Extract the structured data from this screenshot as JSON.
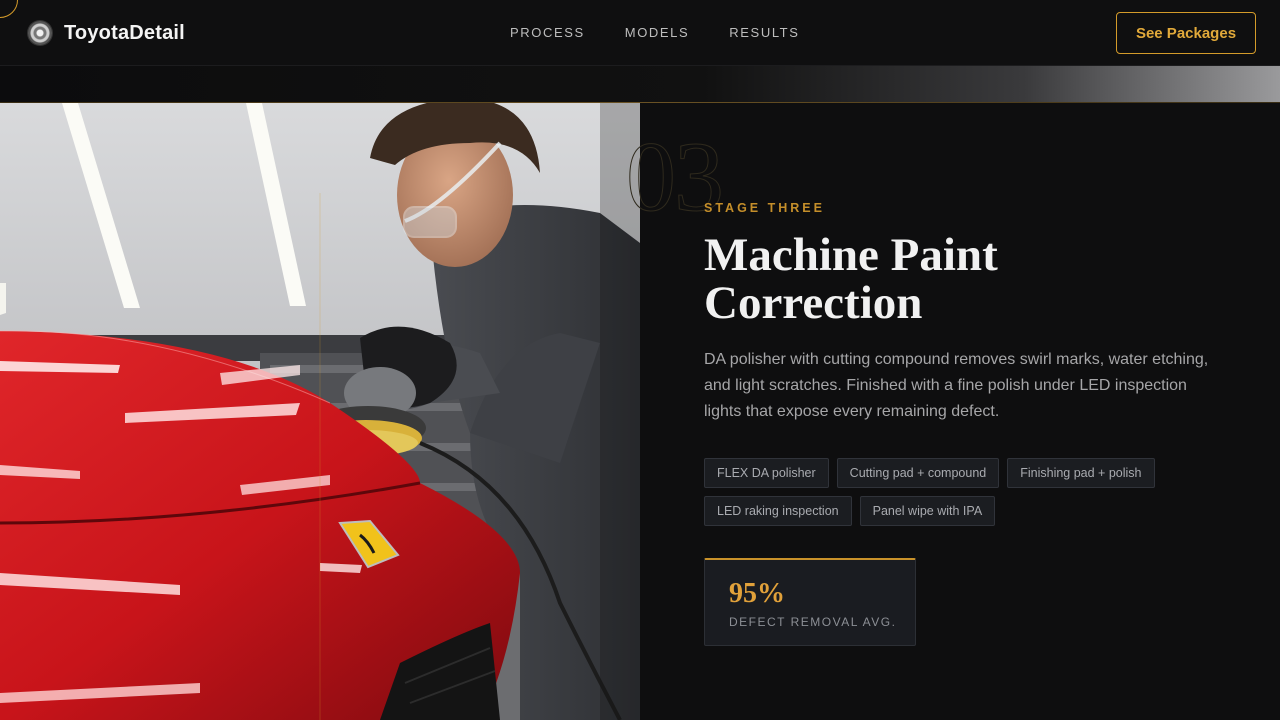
{
  "nav": {
    "brand": "ToyotaDetail",
    "logo_icon": "emblem-icon",
    "links": [
      {
        "label": "PROCESS"
      },
      {
        "label": "MODELS"
      },
      {
        "label": "RESULTS"
      }
    ],
    "cta_label": "See Packages"
  },
  "stage": {
    "number": "03",
    "eyebrow": "STAGE THREE",
    "title": "Machine Paint Correction",
    "description": "DA polisher with cutting compound removes swirl marks, water etching, and light scratches. Finished with a fine polish under LED inspection lights that expose every remaining defect.",
    "tags": [
      {
        "label": "FLEX DA polisher"
      },
      {
        "label": "Cutting pad + compound"
      },
      {
        "label": "Finishing pad + polish"
      },
      {
        "label": "LED raking inspection"
      },
      {
        "label": "Panel wipe with IPA"
      }
    ],
    "stat": {
      "value": "95%",
      "label": "DEFECT REMOVAL AVG."
    }
  },
  "colors": {
    "accent": "#d49b2a",
    "background": "#0e0e0f",
    "car_red": "#c8141a"
  }
}
